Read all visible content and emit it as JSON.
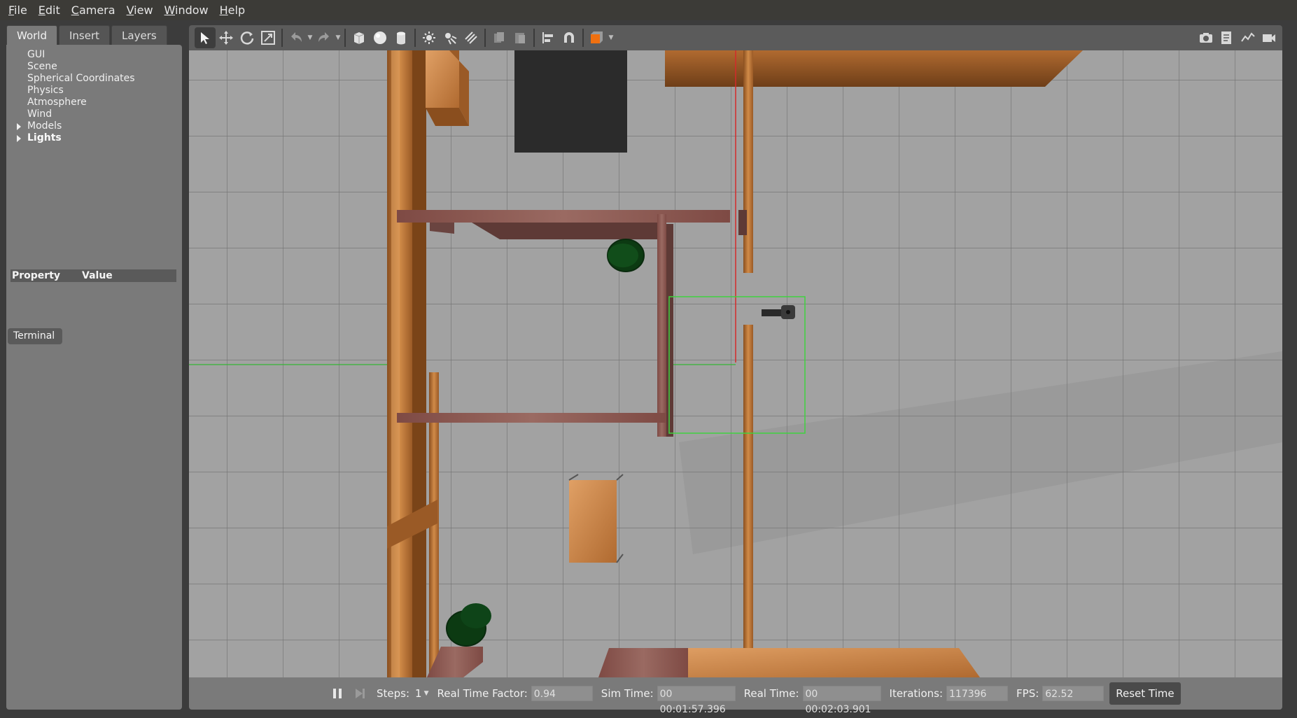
{
  "menu": {
    "file": "File",
    "edit": "Edit",
    "camera": "Camera",
    "view": "View",
    "window": "Window",
    "help": "Help"
  },
  "left_panel": {
    "tabs": [
      {
        "label": "World",
        "active": true
      },
      {
        "label": "Insert",
        "active": false
      },
      {
        "label": "Layers",
        "active": false
      }
    ],
    "tree": [
      {
        "label": "GUI"
      },
      {
        "label": "Scene"
      },
      {
        "label": "Spherical Coordinates"
      },
      {
        "label": "Physics"
      },
      {
        "label": "Atmosphere"
      },
      {
        "label": "Wind"
      },
      {
        "label": "Models"
      },
      {
        "label": "Lights"
      }
    ],
    "property_header": {
      "property": "Property",
      "value": "Value"
    },
    "terminal_label": "Terminal"
  },
  "toolbar": {
    "tools": [
      "select-arrow-icon",
      "translate-icon",
      "rotate-icon",
      "scale-icon",
      "undo-icon",
      "redo-icon",
      "box-icon",
      "sphere-icon",
      "cylinder-icon",
      "point-light-icon",
      "spot-light-icon",
      "directional-light-icon",
      "copy-icon",
      "paste-icon",
      "align-icon",
      "snap-icon",
      "view-angle-icon"
    ],
    "right_tools": [
      "screenshot-icon",
      "log-icon",
      "plot-icon",
      "video-icon"
    ]
  },
  "status": {
    "steps_label": "Steps:",
    "steps_value": "1",
    "rtf_label": "Real Time Factor:",
    "rtf_value": "0.94",
    "sim_time_label": "Sim Time:",
    "sim_time_value": "00 00:01:57.396",
    "real_time_label": "Real Time:",
    "real_time_value": "00 00:02:03.901",
    "iterations_label": "Iterations:",
    "iterations_value": "117396",
    "fps_label": "FPS:",
    "fps_value": "62.52",
    "reset_label": "Reset Time"
  },
  "colors": {
    "viewport_bg": "#9f9f9f",
    "grid": "#6e6e6e",
    "wood": "#c8803f",
    "brick": "#8a5550",
    "selection": "#3fd23f",
    "axis_red": "#d02020",
    "axis_green": "#30b030",
    "dark_model": "#2a2a2a",
    "green_model": "#0c3a12"
  }
}
